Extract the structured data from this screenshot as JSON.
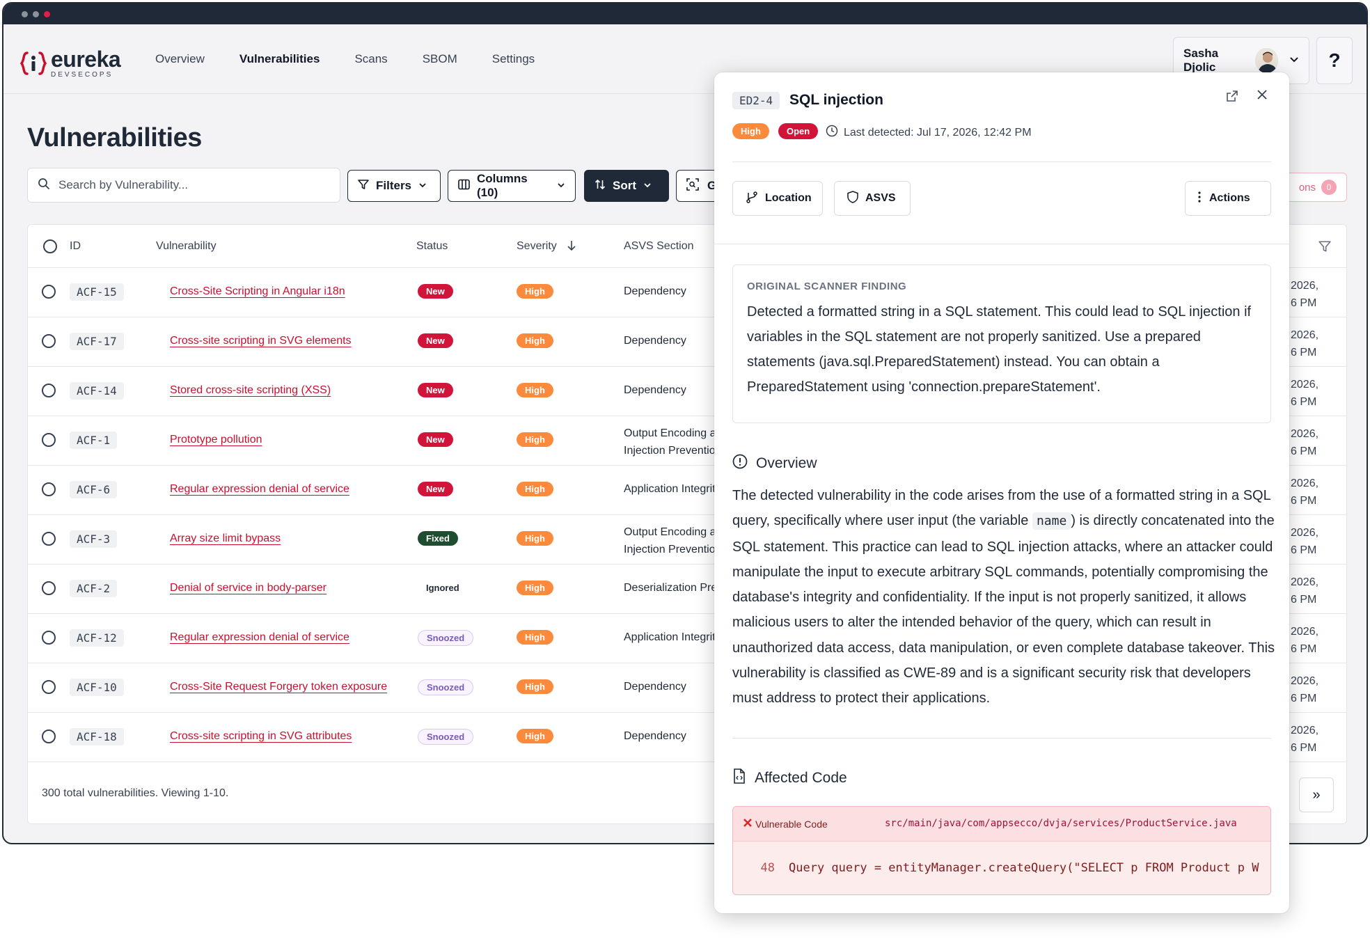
{
  "app": {
    "logo_word": "eureka",
    "logo_sub": "DEVSECOPS",
    "nav": [
      "Overview",
      "Vulnerabilities",
      "Scans",
      "SBOM",
      "Settings"
    ],
    "active_nav": "Vulnerabilities",
    "user_name": "Sasha Djolic",
    "help_label": "?"
  },
  "page": {
    "title": "Vulnerabilities",
    "search_placeholder": "Search by Vulnerability...",
    "toolbar": {
      "filters_label": "Filters",
      "columns_label": "Columns (10)",
      "sort_label": "Sort",
      "group_label": "G",
      "partial_btn_label": "ons",
      "partial_btn_count": "0"
    },
    "columns": [
      "ID",
      "Vulnerability",
      "Status",
      "Severity",
      "ASVS Section"
    ],
    "rows": [
      {
        "id": "ACF-15",
        "vulnerability": "Cross-Site Scripting in Angular i18n",
        "status": "New",
        "severity": "High",
        "asvs": "Dependency",
        "date_a": "2026,",
        "date_b": "6 PM"
      },
      {
        "id": "ACF-17",
        "vulnerability": "Cross-site scripting in SVG elements",
        "status": "New",
        "severity": "High",
        "asvs": "Dependency",
        "date_a": "2026,",
        "date_b": "6 PM"
      },
      {
        "id": "ACF-14",
        "vulnerability": "Stored cross-site scripting (XSS)",
        "status": "New",
        "severity": "High",
        "asvs": "Dependency",
        "date_a": "2026,",
        "date_b": "6 PM"
      },
      {
        "id": "ACF-1",
        "vulnerability": "Prototype pollution",
        "status": "New",
        "severity": "High",
        "asvs": "Output Encoding an Injection Prevention",
        "date_a": "2026,",
        "date_b": "6 PM"
      },
      {
        "id": "ACF-6",
        "vulnerability": "Regular expression denial of service",
        "status": "New",
        "severity": "High",
        "asvs": "Application Integrity",
        "date_a": "2026,",
        "date_b": "6 PM"
      },
      {
        "id": "ACF-3",
        "vulnerability": "Array size limit bypass",
        "status": "Fixed",
        "severity": "High",
        "asvs": "Output Encoding an Injection Prevention",
        "date_a": "2026,",
        "date_b": "6 PM"
      },
      {
        "id": "ACF-2",
        "vulnerability": "Denial of service in body-parser",
        "status": "Ignored",
        "severity": "High",
        "asvs": "Deserialization Prev",
        "date_a": "2026,",
        "date_b": "6 PM"
      },
      {
        "id": "ACF-12",
        "vulnerability": "Regular expression denial of service",
        "status": "Snoozed",
        "severity": "High",
        "asvs": "Application Integrity",
        "date_a": "2026,",
        "date_b": "6 PM"
      },
      {
        "id": "ACF-10",
        "vulnerability": "Cross-Site Request Forgery token exposure",
        "status": "Snoozed",
        "severity": "High",
        "asvs": "Dependency",
        "date_a": "2026,",
        "date_b": "6 PM"
      },
      {
        "id": "ACF-18",
        "vulnerability": "Cross-site scripting in SVG attributes",
        "status": "Snoozed",
        "severity": "High",
        "asvs": "Dependency",
        "date_a": "2026,",
        "date_b": "6 PM"
      }
    ],
    "footer_text": "300 total vulnerabilities. Viewing 1-10.",
    "next_label": "»"
  },
  "panel": {
    "id": "ED2-4",
    "title": "SQL injection",
    "severity": "High",
    "status": "Open",
    "last_detected": "Last detected: Jul 17, 2026, 12:42 PM",
    "buttons": {
      "location": "Location",
      "asvs": "ASVS",
      "actions": "Actions"
    },
    "finding_header": "ORIGINAL SCANNER FINDING",
    "finding_body": "Detected a formatted string in a SQL statement. This could lead to SQL injection if variables in the SQL statement are not properly sanitized. Use a prepared statements (java.sql.PreparedStatement) instead. You can obtain a PreparedStatement using 'connection.prepareStatement'.",
    "overview_title": "Overview",
    "overview_part1": "The detected vulnerability in the code arises from the use of a formatted string in a SQL query, specifically where user input (the variable ",
    "overview_code": "name",
    "overview_part2": ") is directly concatenated into the SQL statement. This practice can lead to SQL injection attacks, where an attacker could manipulate the input to execute arbitrary SQL commands, potentially compromising the database's integrity and confidentiality. If the input is not properly sanitized, it allows malicious users to alter the intended behavior of the query, which can result in unauthorized data access, data manipulation, or even complete database takeover. This vulnerability is classified as CWE-89 and is a significant security risk that developers must address to protect their applications.",
    "affected_title": "Affected Code",
    "vuln_code_label": "Vulnerable Code",
    "file_path": "src/main/java/com/appsecco/dvja/services/ProductService.java",
    "line_number": "48",
    "code_line": "Query query = entityManager.createQuery(\"SELECT p FROM Product p W"
  },
  "colors": {
    "brand_red": "#c8102e",
    "new_badge": "#d0143a",
    "fixed_badge": "#1f4d2f",
    "severity_high": "#fb8a3c",
    "dark": "#1f2937"
  }
}
